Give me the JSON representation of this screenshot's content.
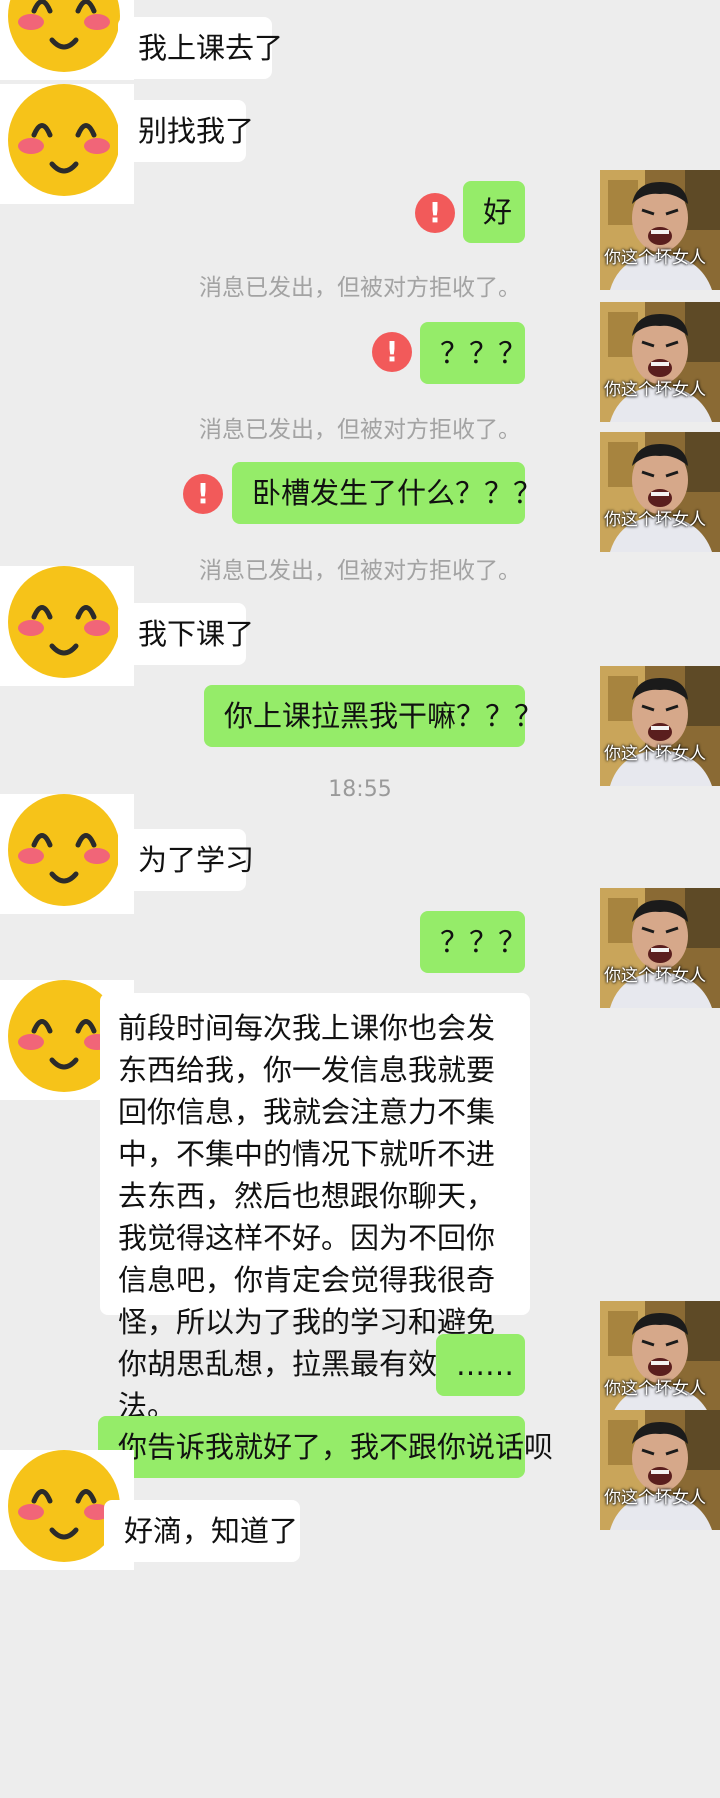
{
  "avatar_caption": "你这个坏女人",
  "messages": [
    {
      "sender": "other",
      "text": "我上课去了"
    },
    {
      "sender": "other",
      "text": "别找我了"
    },
    {
      "sender": "me",
      "text": "好",
      "failed": true
    },
    {
      "notice": "消息已发出，但被对方拒收了。"
    },
    {
      "sender": "me",
      "text": "？？？",
      "failed": true
    },
    {
      "notice": "消息已发出，但被对方拒收了。"
    },
    {
      "sender": "me",
      "text": "卧槽发生了什么？？？",
      "failed": true
    },
    {
      "notice": "消息已发出，但被对方拒收了。"
    },
    {
      "sender": "other",
      "text": "我下课了"
    },
    {
      "sender": "me",
      "text": "你上课拉黑我干嘛？？？"
    },
    {
      "time": "18:55"
    },
    {
      "sender": "other",
      "text": "为了学习"
    },
    {
      "sender": "me",
      "text": "？？？"
    },
    {
      "sender": "other",
      "text": "前段时间每次我上课你也会发东西给我，你一发信息我就要回你信息，我就会注意力不集中，不集中的情况下就听不进去东西，然后也想跟你聊天，我觉得这样不好。因为不回你信息吧，你肯定会觉得我很奇怪，所以为了我的学习和避免你胡思乱想，拉黑最有效的方法。"
    },
    {
      "sender": "me",
      "text": "……"
    },
    {
      "sender": "me",
      "text": "你告诉我就好了，我不跟你说话呗"
    },
    {
      "sender": "other",
      "text": "好滴，知道了"
    }
  ]
}
